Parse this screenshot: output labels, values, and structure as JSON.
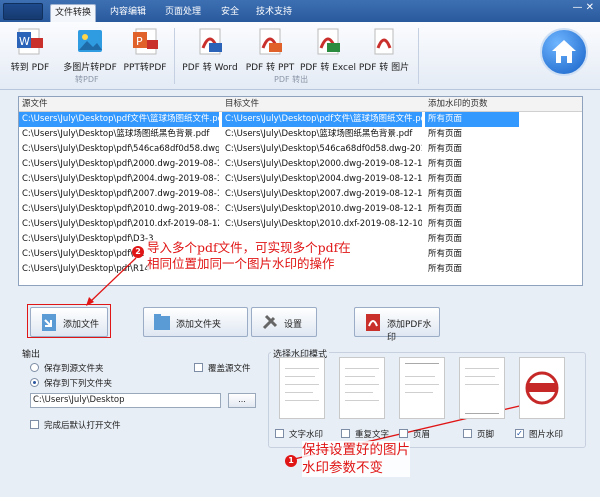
{
  "menu": {
    "tabs": [
      "文件转换",
      "内容编辑",
      "页面处理",
      "安全",
      "技术支持"
    ],
    "active_tab": 0,
    "window_controls": "— ✕"
  },
  "ribbon": {
    "to_pdf_buttons": [
      "转到 PDF",
      "多图片转PDF",
      "PPT转PDF"
    ],
    "to_pdf_group": "转PDF",
    "from_pdf_buttons": [
      "PDF 转 Word",
      "PDF 转 PPT",
      "PDF 转 Excel",
      "PDF 转 图片"
    ],
    "from_pdf_group": "PDF 转出"
  },
  "table": {
    "headers": [
      "源文件",
      "目标文件",
      "添加水印的页数"
    ],
    "rows": [
      [
        "C:\\Users\\July\\Desktop\\pdf文件\\篮球场图纸文件.pdf",
        "C:\\Users\\July\\Desktop\\pdf文件\\篮球场图纸文件.pdf",
        "所有页面"
      ],
      [
        "C:\\Users\\July\\Desktop\\篮球场图纸黑色背景.pdf",
        "C:\\Users\\July\\Desktop\\篮球场图纸黑色背景.pdf",
        "所有页面"
      ],
      [
        "C:\\Users\\July\\Desktop\\pdf\\546ca68df0d58.dwg-201...",
        "C:\\Users\\July\\Desktop\\546ca68df0d58.dwg-2019-0...",
        "所有页面"
      ],
      [
        "C:\\Users\\July\\Desktop\\pdf\\2000.dwg-2019-08-12-1...",
        "C:\\Users\\July\\Desktop\\2000.dwg-2019-08-12-10-0...",
        "所有页面"
      ],
      [
        "C:\\Users\\July\\Desktop\\pdf\\2004.dwg-2019-08-12-1...",
        "C:\\Users\\July\\Desktop\\2004.dwg-2019-08-12-10-0...",
        "所有页面"
      ],
      [
        "C:\\Users\\July\\Desktop\\pdf\\2007.dwg-2019-08-12-1...",
        "C:\\Users\\July\\Desktop\\2007.dwg-2019-08-12-10-0...",
        "所有页面"
      ],
      [
        "C:\\Users\\July\\Desktop\\pdf\\2010.dwg-2019-08-12-1...",
        "C:\\Users\\July\\Desktop\\2010.dwg-2019-08-12-10-0...",
        "所有页面"
      ],
      [
        "C:\\Users\\July\\Desktop\\pdf\\2010.dxf-2019-08-12-1...",
        "C:\\Users\\July\\Desktop\\2010.dxf-2019-08-12-10-01-...",
        "所有页面"
      ],
      [
        "C:\\Users\\July\\Desktop\\pdf\\D3-3",
        "",
        "所有页面"
      ],
      [
        "C:\\Users\\July\\Desktop\\pdf\\R1",
        "",
        "所有页面"
      ],
      [
        "C:\\Users\\July\\Desktop\\pdf\\R14",
        "",
        "所有页面"
      ]
    ]
  },
  "annotations": {
    "note_top_line1": "导入多个pdf文件，可实现多个pdf在",
    "note_top_line2": "相同位置加同一个图片水印的操作",
    "badge_top": "2",
    "note_bottom_line1": "保持设置好的图片",
    "note_bottom_line2": "水印参数不变",
    "badge_bottom": "1"
  },
  "actions": {
    "add_file": "添加文件",
    "add_folder": "添加文件夹",
    "settings": "设置",
    "add_watermark": "添加PDF水印"
  },
  "output": {
    "title": "输出",
    "save_to_source": "保存到源文件夹",
    "overwrite_source": "覆盖源文件",
    "save_to_folder": "保存到下列文件夹",
    "path": "C:\\Users\\July\\Desktop",
    "browse": "...",
    "open_after": "完成后默认打开文件"
  },
  "watermark": {
    "title": "选择水印模式",
    "modes": [
      "文字水印",
      "重复文字",
      "页眉",
      "页脚",
      "图片水印"
    ],
    "checked": [
      false,
      false,
      false,
      false,
      true
    ]
  },
  "colors": {
    "accent": "#3399ff",
    "annotation": "#e01515"
  }
}
